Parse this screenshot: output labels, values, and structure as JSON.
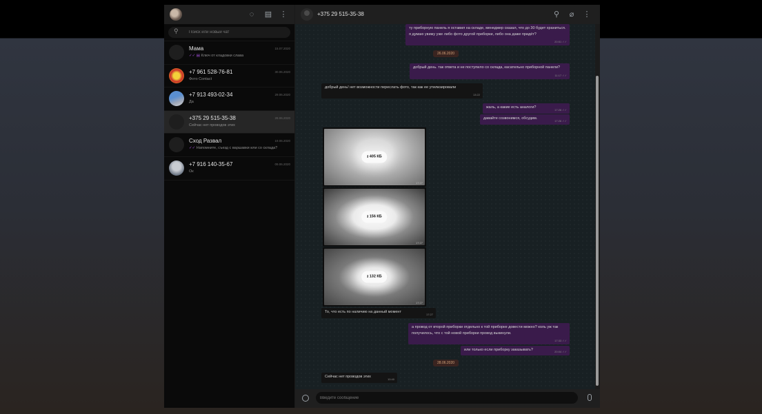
{
  "sidebar": {
    "search_placeholder": "Поиск или новый чат",
    "chats": [
      {
        "name": "Мама",
        "time": "15.07.2020",
        "last": "Ключ от кладовки слава",
        "prefix": "✓✓ ▤"
      },
      {
        "name": "+7 961 528-76-81",
        "time": "30.06.2020",
        "last": "Фото Contact",
        "prefix": ""
      },
      {
        "name": "+7 913 493-02-34",
        "time": "29.06.2020",
        "last": "Да",
        "prefix": ""
      },
      {
        "name": "+375 29 515-35-38",
        "time": "28.06.2020",
        "last": "Сейчас нет проводов этих",
        "prefix": ""
      },
      {
        "name": "Сход Развал",
        "time": "19.06.2020",
        "last": "Напомните, съезд с варшавки или со склада?",
        "prefix": "✓✓"
      },
      {
        "name": "+7 916 140-35-67",
        "time": "09.06.2020",
        "last": "Ок",
        "prefix": ""
      }
    ]
  },
  "main": {
    "contact_name": "+375 29 515-35-38",
    "compose_placeholder": "Введите сообщение"
  },
  "messages": {
    "m1_text": "ту приборную панель я оставил на складе, менеджер сказал, что до 30 будет храниться. я думаю увижу уже либо фото другой приборки, либо она даже придёт?",
    "m1_time": "20:51 ✓✓",
    "date1": "26.06.2020",
    "m2_text": "добрый день. так ответа и не поступило со склада, касательно приборной панели?",
    "m2_time": "11:17 ✓✓",
    "m3_text": "добрый день! нет возможности переслать фото, так как ее утилизировали",
    "m3_time": "13:22",
    "m4_text": "жаль, а какие есть аналоги?",
    "m4_time": "17:26 ✓✓",
    "m5_text": "давайте созвонимся, обсудим.",
    "m5_time": "17:26 ✓✓",
    "img1_size": "405 КБ",
    "img1_time": "17:27",
    "img2_size": "156 КБ",
    "img2_time": "17:27",
    "img3_size": "132 КБ",
    "img3_time": "17:27",
    "m6_text": "То, что есть по наличию на данный момент",
    "m6_time": "17:27",
    "m7_text": "а провод от второй приборки отдельно к той приборке довести можно? коль уж так получилось, что с той новой приборки провод выкинули.",
    "m7_time": "17:33 ✓✓",
    "m8_text": "или только если приборку заказывать?",
    "m8_time": "20:04 ✓✓",
    "date2": "28.06.2020",
    "m9_text": "Сейчас нет проводов этих",
    "m9_time": "10:40"
  }
}
